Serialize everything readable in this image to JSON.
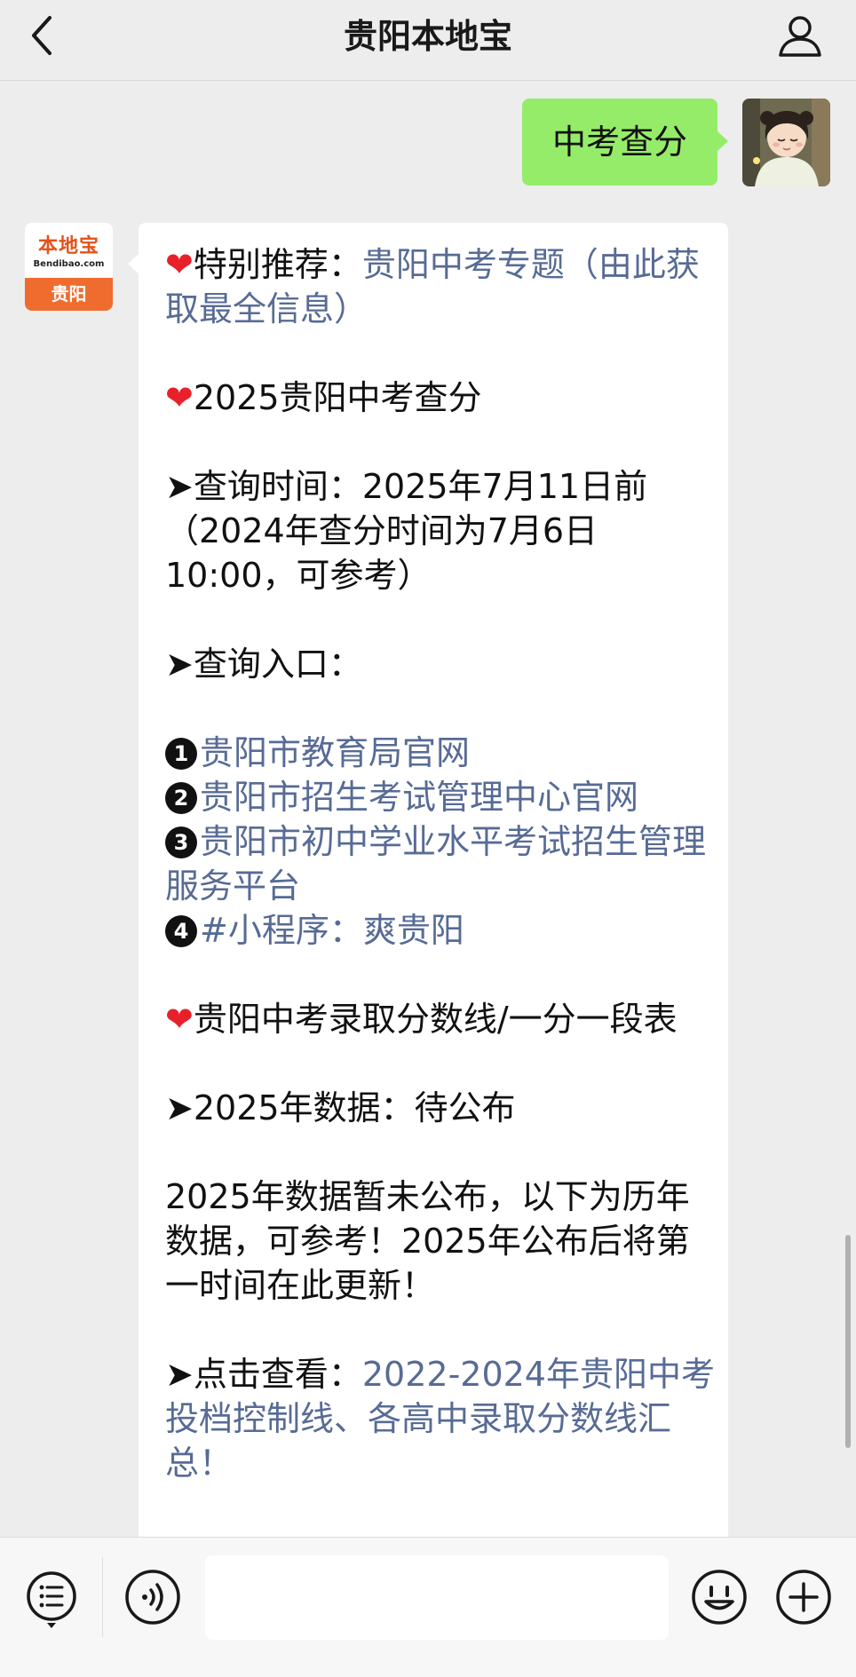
{
  "header": {
    "title": "贵阳本地宝",
    "back_icon": "chevron-left-icon",
    "profile_icon": "person-icon"
  },
  "chat": {
    "outgoing_message": "中考查分",
    "sender_avatar": {
      "logo_text": "本地宝",
      "logo_subtext": "Bendibao.com",
      "city_label": "贵阳"
    },
    "article": {
      "heart": "❤",
      "p1_label": "特别推荐：",
      "p1_link": "贵阳中考专题（由此获取最全信息）",
      "p2_text": "2025贵阳中考查分",
      "arrow": "➤",
      "p3_text": "查询时间：2025年7月11日前（2024年查分时间为7月6日10:00，可参考）",
      "p4_text": "查询入口：",
      "entries": [
        {
          "num": "1",
          "text": "贵阳市教育局官网"
        },
        {
          "num": "2",
          "text": "贵阳市招生考试管理中心官网"
        },
        {
          "num": "3",
          "text": "贵阳市初中学业水平考试招生管理服务平台"
        },
        {
          "num": "4",
          "text": "#小程序：爽贵阳"
        }
      ],
      "p5_text": "贵阳中考录取分数线/一分一段表",
      "p6_text": "2025年数据：待公布",
      "p7_text": "2025年数据暂未公布，以下为历年数据，可参考！2025年公布后将第一时间在此更新！",
      "p8_label": "点击查看：",
      "p8_link": "2022-2024年贵阳中考投档控制线、各高中录取分数线汇总！"
    }
  },
  "inputbar": {
    "menu_icon": "menu-list-icon",
    "voice_icon": "voice-icon",
    "input_placeholder": "",
    "emoji_icon": "emoji-icon",
    "plus_icon": "plus-icon"
  },
  "colors": {
    "background": "#ededed",
    "outgoing_bubble": "#95ec69",
    "link": "#576b95",
    "heart": "#e8202a",
    "logo_orange": "#ef6c2e"
  }
}
